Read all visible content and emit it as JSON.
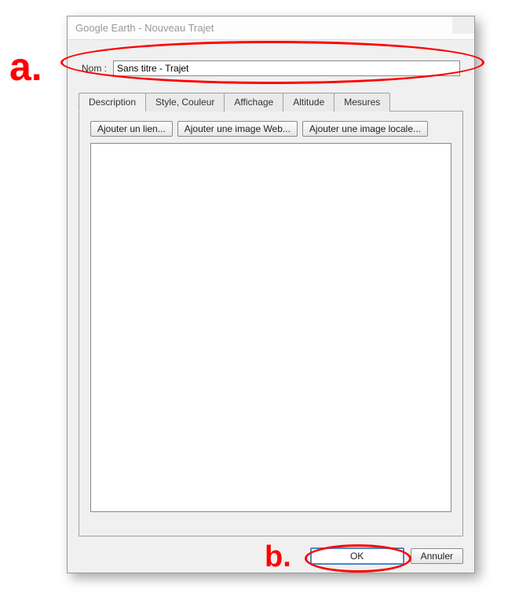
{
  "window_title": "Google Earth - Nouveau Trajet",
  "name_field": {
    "label": "Nom :",
    "value": "Sans titre - Trajet"
  },
  "tabs": {
    "description": "Description",
    "style": "Style, Couleur",
    "display": "Affichage",
    "altitude": "Altitude",
    "measures": "Mesures"
  },
  "desc_buttons": {
    "add_link": "Ajouter un lien...",
    "add_web_image": "Ajouter une image Web...",
    "add_local_image": "Ajouter une image locale..."
  },
  "description_value": "",
  "footer_buttons": {
    "ok": "OK",
    "cancel": "Annuler"
  },
  "annotations": {
    "a": "a.",
    "b": "b."
  }
}
